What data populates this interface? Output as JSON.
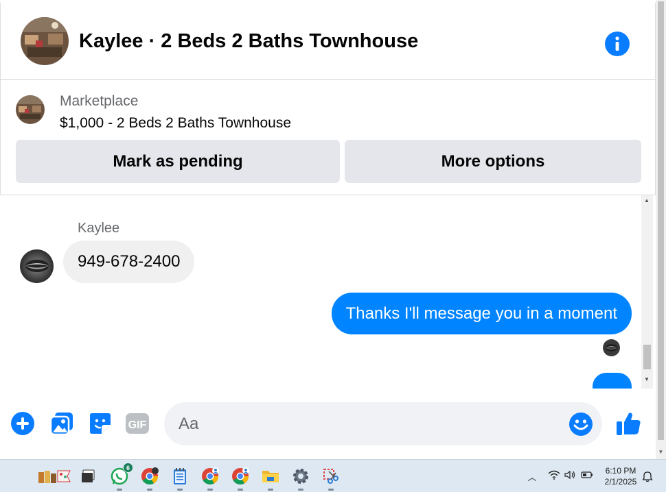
{
  "header": {
    "title": "Kaylee · 2 Beds 2 Baths Townhouse"
  },
  "listing": {
    "source": "Marketplace",
    "price_title": "$1,000 - 2 Beds 2 Baths Townhouse",
    "mark_pending_label": "Mark as pending",
    "more_options_label": "More options"
  },
  "conversation": {
    "sender_name": "Kaylee",
    "incoming_message": "949-678-2400",
    "outgoing_message": "Thanks I'll message you in a moment"
  },
  "composer": {
    "placeholder": "Aa",
    "gif_label": "GIF"
  },
  "taskbar": {
    "whatsapp_badge": "6",
    "time": "6:10 PM",
    "date": "2/1/2025"
  },
  "colors": {
    "messenger_blue": "#0084ff",
    "icon_blue": "#0a7cff",
    "button_gray": "#e4e6eb",
    "incoming_bubble": "#f0f0f0"
  }
}
